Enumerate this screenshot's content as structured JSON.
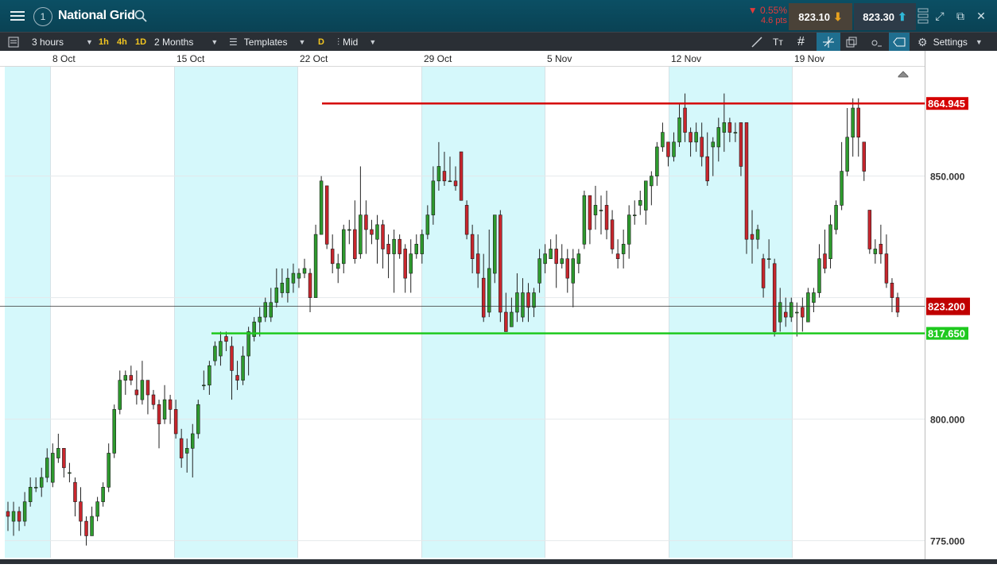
{
  "header": {
    "instrument": "National Grid",
    "change_pct": "0.55%",
    "change_pts": "4.6 pts",
    "sell_price": "823.10",
    "buy_price": "823.30",
    "colors": {
      "bg": "#0b4f64",
      "negative": "#e23b3b",
      "sell_arrow": "#e8a21e",
      "buy_arrow": "#2fb8d8"
    }
  },
  "toolbar": {
    "interval": "3 hours",
    "quick_intervals": [
      "1h",
      "4h",
      "1D"
    ],
    "range": "2 Months",
    "templates_label": "Templates",
    "d_label": "D",
    "price_type": "Mid",
    "settings_label": "Settings"
  },
  "chart_data": {
    "type": "candlestick",
    "date_labels": [
      "8 Oct",
      "15 Oct",
      "22 Oct",
      "29 Oct",
      "5 Nov",
      "12 Nov",
      "19 Nov"
    ],
    "y_ticks": [
      "850.000",
      "800.000",
      "775.000"
    ],
    "y_range": [
      771.5,
      872.5
    ],
    "resistance": {
      "value": 864.945,
      "label": "864.945",
      "color": "#d50000"
    },
    "support": {
      "value": 817.65,
      "label": "817.650",
      "color": "#1ec91e"
    },
    "current": {
      "value": 823.2,
      "label": "823.200",
      "color": "#c00000"
    },
    "candles": [
      [
        781,
        780,
        783,
        777
      ],
      [
        779,
        781,
        783,
        776
      ],
      [
        781,
        779,
        782,
        777
      ],
      [
        779,
        783,
        785,
        778
      ],
      [
        783,
        786,
        788,
        782
      ],
      [
        786,
        786,
        788,
        785
      ],
      [
        786,
        788,
        790,
        784
      ],
      [
        788,
        792,
        794,
        787
      ],
      [
        787,
        793,
        795,
        786
      ],
      [
        792,
        794,
        797,
        791
      ],
      [
        794,
        790,
        794,
        788
      ],
      [
        789,
        789,
        791,
        787
      ],
      [
        787,
        783,
        788,
        780
      ],
      [
        783,
        779,
        786,
        776
      ],
      [
        779,
        776,
        780,
        774
      ],
      [
        776,
        780,
        782,
        777
      ],
      [
        780,
        783,
        784,
        779
      ],
      [
        783,
        786,
        787,
        782
      ],
      [
        786,
        793,
        795,
        785
      ],
      [
        793,
        802,
        803,
        792
      ],
      [
        802,
        808,
        810,
        801
      ],
      [
        808,
        809,
        810,
        805
      ],
      [
        809,
        808,
        811,
        807
      ],
      [
        806,
        805,
        810,
        803
      ],
      [
        804,
        808,
        812,
        803
      ],
      [
        808,
        805,
        808,
        801
      ],
      [
        805,
        803,
        806,
        802
      ],
      [
        803,
        799,
        804,
        794
      ],
      [
        800,
        804,
        807,
        799
      ],
      [
        804,
        802,
        805,
        799
      ],
      [
        802,
        797,
        804,
        796
      ],
      [
        796,
        792,
        798,
        790
      ],
      [
        793,
        794,
        796,
        789
      ],
      [
        794,
        797,
        799,
        788
      ],
      [
        797,
        803,
        804,
        796
      ],
      [
        807,
        807,
        810,
        806
      ],
      [
        807,
        811,
        812,
        805
      ],
      [
        812,
        815,
        816,
        811
      ],
      [
        813,
        816,
        818,
        811
      ],
      [
        817,
        816,
        818,
        814
      ],
      [
        815,
        810,
        817,
        804
      ],
      [
        809,
        808,
        812,
        806
      ],
      [
        808,
        813,
        815,
        807
      ],
      [
        813,
        818,
        819,
        809
      ],
      [
        817,
        820,
        821,
        816
      ],
      [
        820,
        821,
        823,
        817
      ],
      [
        821,
        824,
        825,
        820
      ],
      [
        821,
        824,
        827,
        820
      ],
      [
        824,
        827,
        831,
        823
      ],
      [
        826,
        828,
        831,
        825
      ],
      [
        826,
        829,
        831,
        824
      ],
      [
        828,
        830,
        832,
        826
      ],
      [
        829,
        830,
        831,
        827
      ],
      [
        830,
        831,
        833,
        829
      ],
      [
        830,
        825,
        831,
        822
      ],
      [
        825,
        838,
        840,
        825
      ],
      [
        838,
        849,
        850,
        838
      ],
      [
        848,
        836,
        848,
        835
      ],
      [
        835,
        832,
        838,
        830
      ],
      [
        831,
        832,
        834,
        828
      ],
      [
        832,
        839,
        840,
        830
      ],
      [
        839,
        839,
        841,
        836
      ],
      [
        839,
        833,
        845,
        832
      ],
      [
        834,
        842,
        852,
        833
      ],
      [
        842,
        839,
        845,
        834
      ],
      [
        839,
        838,
        841,
        836
      ],
      [
        837,
        840,
        842,
        832
      ],
      [
        840,
        835,
        841,
        831
      ],
      [
        836,
        834,
        838,
        829
      ],
      [
        834,
        837,
        839,
        826
      ],
      [
        837,
        834,
        838,
        833
      ],
      [
        835,
        829,
        836,
        826
      ],
      [
        830,
        834,
        837,
        826
      ],
      [
        834,
        836,
        838,
        833
      ],
      [
        834,
        838,
        839,
        832
      ],
      [
        838,
        842,
        844,
        837
      ],
      [
        842,
        849,
        852,
        840
      ],
      [
        849,
        852,
        857,
        847
      ],
      [
        851,
        849,
        855,
        848
      ],
      [
        849,
        849,
        854,
        849
      ],
      [
        849,
        848,
        852,
        847
      ],
      [
        855,
        845,
        855,
        845
      ],
      [
        844,
        838,
        845,
        837
      ],
      [
        838,
        833,
        840,
        830
      ],
      [
        834,
        830,
        838,
        827
      ],
      [
        829,
        821,
        834,
        820
      ],
      [
        822,
        831,
        839,
        821
      ],
      [
        830,
        842,
        842,
        828
      ],
      [
        842,
        822,
        843,
        820
      ],
      [
        822,
        818,
        826,
        819
      ],
      [
        819,
        822,
        825,
        820
      ],
      [
        822,
        826,
        830,
        820
      ],
      [
        821,
        826,
        829,
        820
      ],
      [
        826,
        823,
        828,
        820
      ],
      [
        823,
        826,
        827,
        821
      ],
      [
        828,
        833,
        835,
        826
      ],
      [
        832,
        834,
        836,
        830
      ],
      [
        833,
        835,
        837,
        834
      ],
      [
        835,
        832,
        838,
        827
      ],
      [
        832,
        833,
        836,
        831
      ],
      [
        833,
        829,
        835,
        826
      ],
      [
        828,
        833,
        835,
        823
      ],
      [
        832,
        834,
        835,
        830
      ],
      [
        836,
        846,
        847,
        835
      ],
      [
        846,
        839,
        846,
        836
      ],
      [
        842,
        844,
        848,
        839
      ],
      [
        843,
        843,
        846,
        838
      ],
      [
        844,
        839,
        847,
        837
      ],
      [
        841,
        835,
        843,
        834
      ],
      [
        834,
        833,
        837,
        831
      ],
      [
        834,
        836,
        839,
        831
      ],
      [
        836,
        842,
        844,
        833
      ],
      [
        842,
        842,
        845,
        840
      ],
      [
        844,
        845,
        847,
        842
      ],
      [
        843,
        849,
        849,
        840
      ],
      [
        848,
        850,
        851,
        844
      ],
      [
        850,
        856,
        857,
        848
      ],
      [
        856,
        859,
        861,
        855
      ],
      [
        857,
        854,
        857,
        852
      ],
      [
        854,
        857,
        859,
        853
      ],
      [
        857,
        862,
        865,
        856
      ],
      [
        864,
        859,
        867,
        857
      ],
      [
        859,
        857,
        860,
        854
      ],
      [
        857,
        859,
        861,
        855
      ],
      [
        858,
        854,
        861,
        852
      ],
      [
        854,
        849,
        859,
        848
      ],
      [
        856,
        857,
        858,
        850
      ],
      [
        856,
        860,
        862,
        853
      ],
      [
        859,
        861,
        867,
        855
      ],
      [
        861,
        859,
        862,
        857
      ],
      [
        859,
        859,
        861,
        857
      ],
      [
        861,
        852,
        861,
        850
      ],
      [
        861,
        837,
        861,
        834
      ],
      [
        838,
        837,
        843,
        832
      ],
      [
        837,
        839,
        840,
        835
      ],
      [
        833,
        827,
        834,
        825
      ],
      [
        833,
        833,
        837,
        831
      ],
      [
        832,
        818,
        833,
        817
      ],
      [
        820,
        824,
        827,
        818
      ],
      [
        822,
        821,
        825,
        819
      ],
      [
        821,
        824,
        825,
        820
      ],
      [
        822,
        822,
        824,
        817
      ],
      [
        823,
        821,
        825,
        818
      ],
      [
        820,
        826,
        827,
        820
      ],
      [
        824,
        826,
        827,
        822
      ],
      [
        826,
        833,
        836,
        825
      ],
      [
        834,
        831,
        839,
        830
      ],
      [
        833,
        840,
        842,
        831
      ],
      [
        839,
        844,
        845,
        838
      ],
      [
        844,
        851,
        857,
        843
      ],
      [
        851,
        858,
        864,
        850
      ],
      [
        858,
        864,
        866,
        854
      ],
      [
        864,
        858,
        866,
        854
      ],
      [
        857,
        851,
        857,
        849
      ],
      [
        843,
        835,
        843,
        834
      ],
      [
        834,
        835,
        837,
        832
      ],
      [
        836,
        834,
        840,
        832
      ],
      [
        834,
        828,
        838,
        827
      ],
      [
        828,
        825,
        829,
        822
      ],
      [
        825,
        822,
        826,
        821
      ]
    ]
  }
}
